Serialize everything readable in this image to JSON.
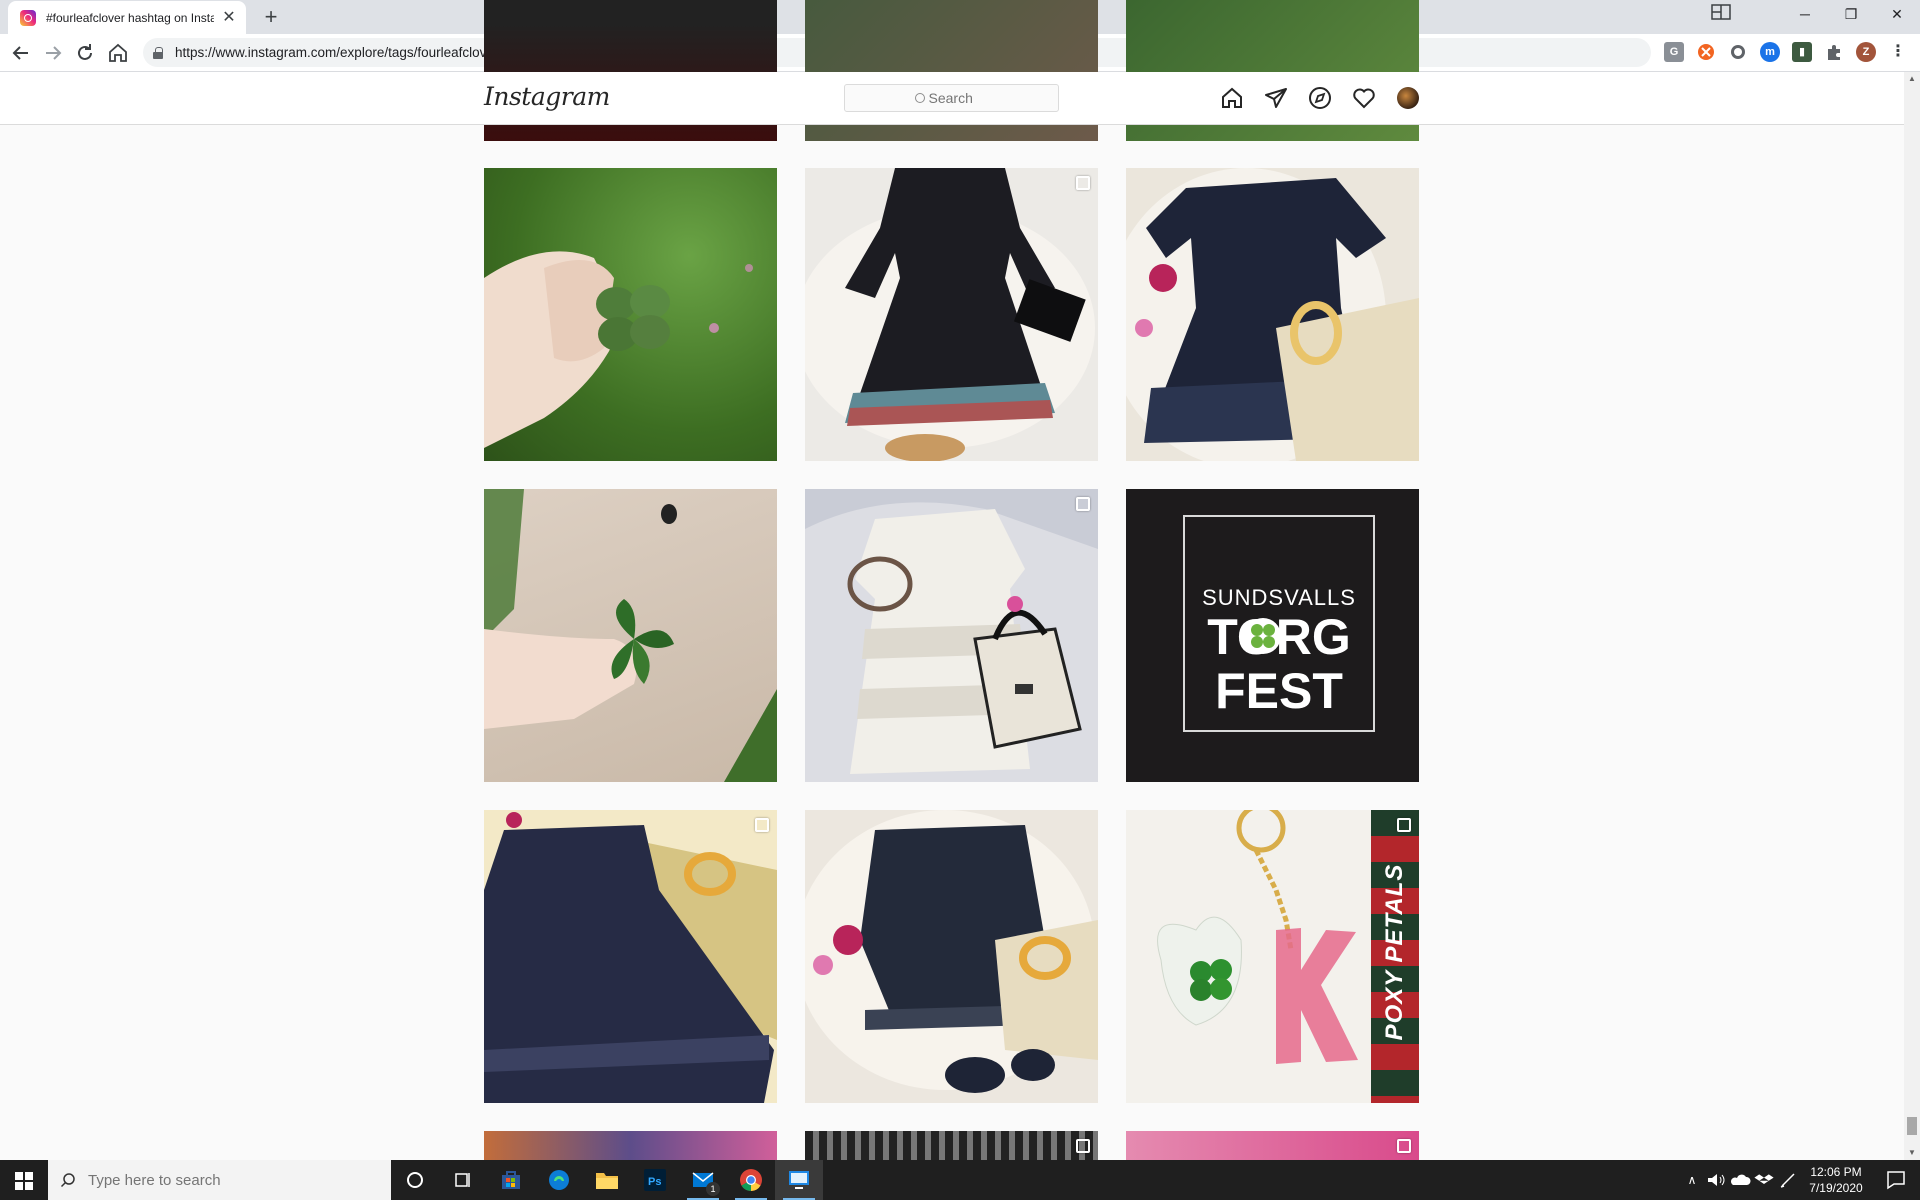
{
  "browser": {
    "tab_title": "#fourleafclover hashtag on Instagram",
    "tab_close": "✕",
    "new_tab": "+",
    "url": "https://www.instagram.com/explore/tags/fourleafclover/",
    "profile_initial": "Z",
    "window_buttons": {
      "minimize": "─",
      "restore": "❐",
      "close": "✕"
    }
  },
  "instagram": {
    "logo": "Instagram",
    "search_placeholder": "Search"
  },
  "posts": {
    "torgfest": {
      "line1": "SUNDSVALLS",
      "line2_a": "TOR",
      "line2_b": "G",
      "line3": "FEST"
    },
    "keychain_banner": "POXY PETALS"
  },
  "taskbar": {
    "search_placeholder": "Type here to search",
    "mail_badge": "1",
    "time": "12:06 PM",
    "date": "7/19/2020"
  }
}
